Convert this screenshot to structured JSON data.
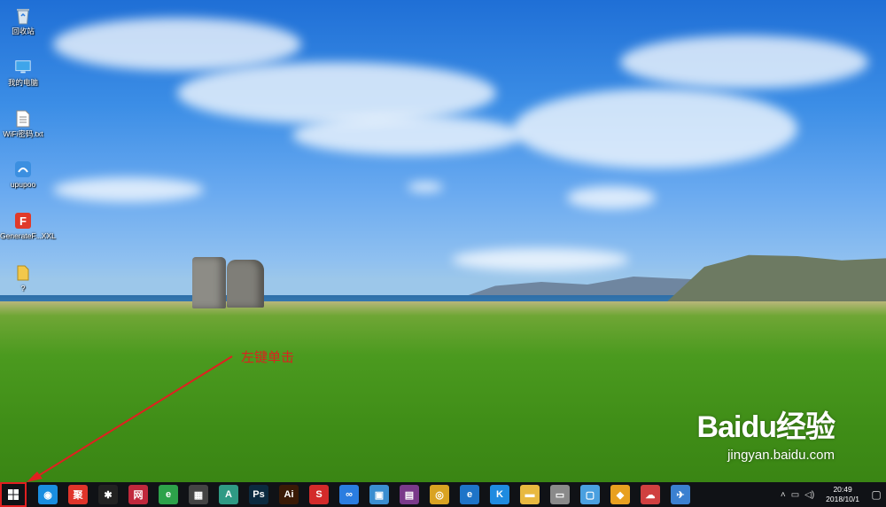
{
  "desktop_icons": [
    {
      "label": "回收站",
      "icon": "recycle-bin-icon"
    },
    {
      "label": "我的电脑",
      "icon": "computer-icon"
    },
    {
      "label": "WiFi密码.txt",
      "icon": "text-file-icon"
    },
    {
      "label": "upupoo",
      "icon": "upupoo-icon"
    },
    {
      "label": "GenerateF...XXL",
      "icon": "generatef-app-icon"
    },
    {
      "label": "?",
      "icon": "folder-icon"
    }
  ],
  "annotation": {
    "text": "左键单击",
    "color": "#d9231e"
  },
  "watermark": {
    "logo": "Baidu经验",
    "url": "jingyan.baidu.com"
  },
  "taskbar": {
    "apps": [
      {
        "name": "app-blue-cloud",
        "glyph": "◉",
        "color": "#1a8ee0"
      },
      {
        "name": "app-kuaibo",
        "glyph": "聚",
        "color": "#e0342a"
      },
      {
        "name": "app-penguin",
        "glyph": "✱",
        "color": "#222222"
      },
      {
        "name": "app-red-circle",
        "glyph": "网",
        "color": "#c0283c"
      },
      {
        "name": "app-360-browser",
        "glyph": "e",
        "color": "#2da24a"
      },
      {
        "name": "app-calculator",
        "glyph": "▦",
        "color": "#444444"
      },
      {
        "name": "app-green-doc",
        "glyph": "A",
        "color": "#2f9a84"
      },
      {
        "name": "app-photoshop",
        "glyph": "Ps",
        "color": "#0b2a3f"
      },
      {
        "name": "app-illustrator",
        "glyph": "Ai",
        "color": "#3a1a06"
      },
      {
        "name": "app-wps",
        "glyph": "S",
        "color": "#d32a2a"
      },
      {
        "name": "app-baidu-netdisk",
        "glyph": "∞",
        "color": "#2a7de0"
      },
      {
        "name": "app-remote-desktop",
        "glyph": "▣",
        "color": "#3b8ed0"
      },
      {
        "name": "app-winrar",
        "glyph": "▤",
        "color": "#7a3a8a"
      },
      {
        "name": "app-chrome",
        "glyph": "◎",
        "color": "#d9a322"
      },
      {
        "name": "app-edge",
        "glyph": "e",
        "color": "#1e74c8"
      },
      {
        "name": "app-kugou",
        "glyph": "K",
        "color": "#1f8be0"
      },
      {
        "name": "app-file-explorer",
        "glyph": "▬",
        "color": "#e8b940"
      },
      {
        "name": "app-printer",
        "glyph": "▭",
        "color": "#8a8a8a"
      },
      {
        "name": "app-store",
        "glyph": "▢",
        "color": "#4aa0e0"
      },
      {
        "name": "app-shield",
        "glyph": "◆",
        "color": "#e8a020"
      },
      {
        "name": "app-cloud-red",
        "glyph": "☁",
        "color": "#d04040"
      },
      {
        "name": "app-thunder",
        "glyph": "✈",
        "color": "#3b80d0"
      }
    ],
    "tray": {
      "time": "20:49",
      "date": "2018/10/1"
    }
  }
}
